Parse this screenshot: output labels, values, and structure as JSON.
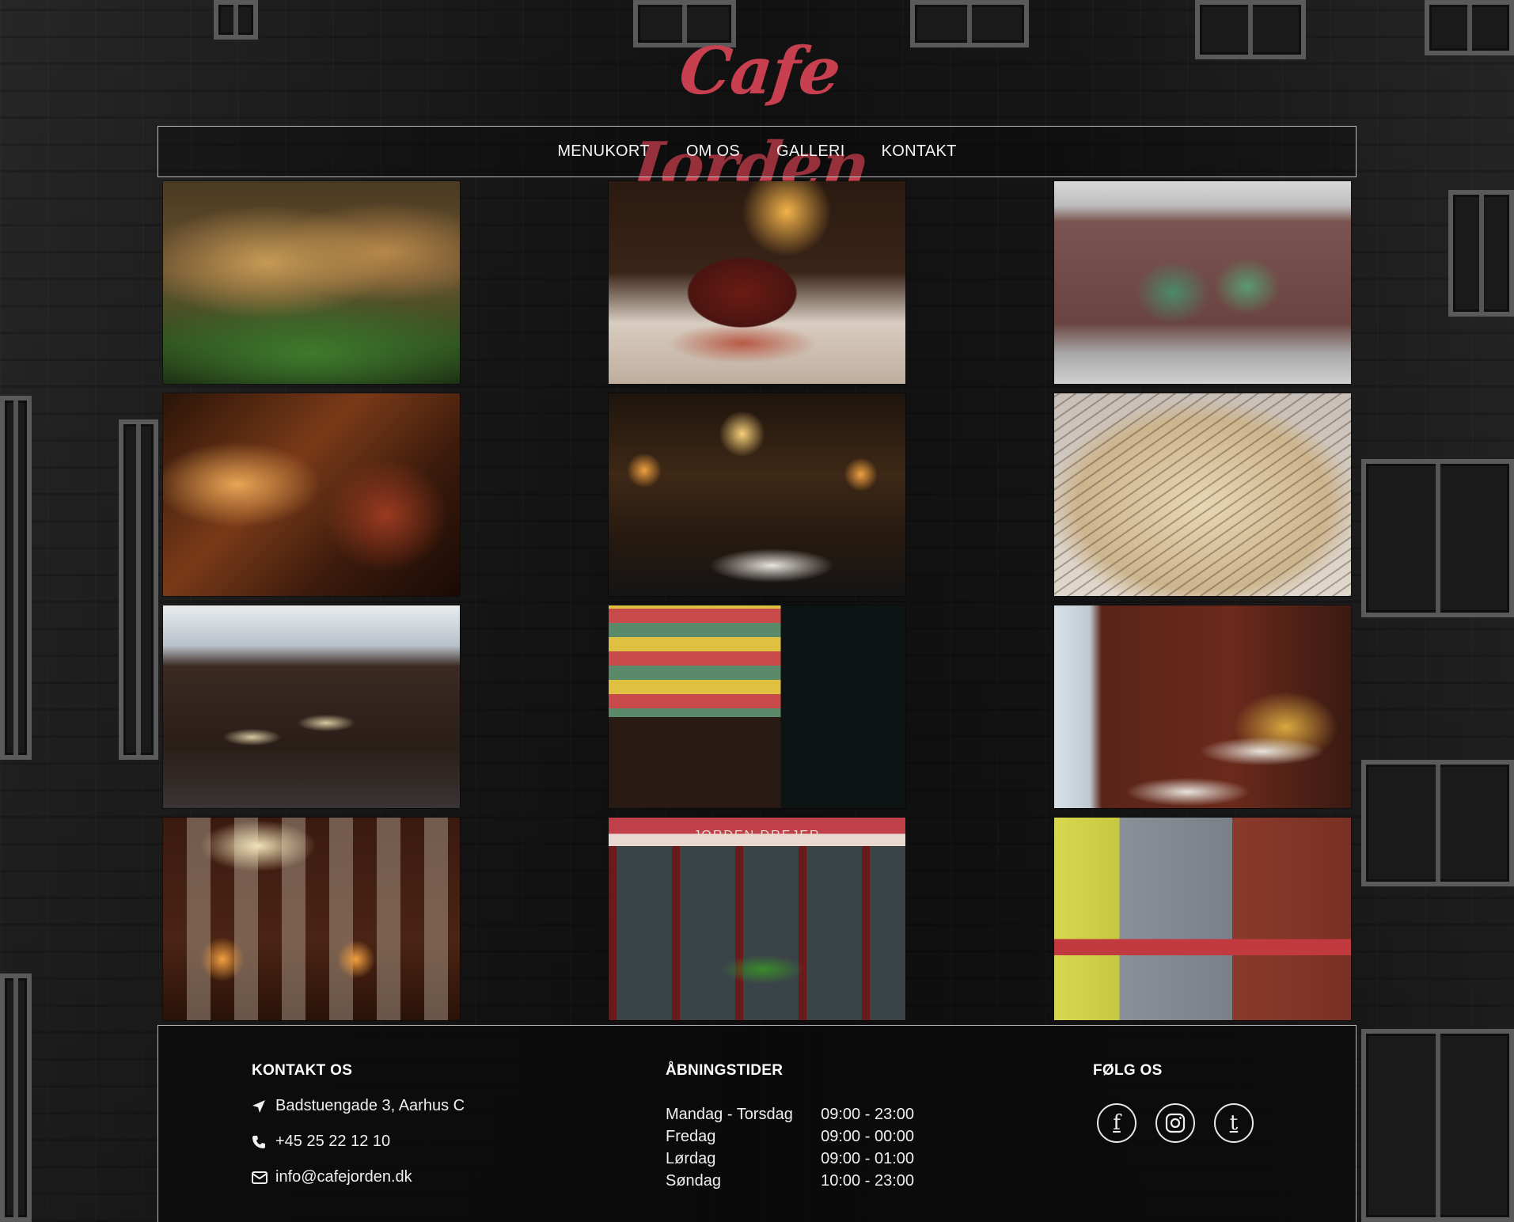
{
  "site": {
    "logo_text": "Cafe Jorden",
    "brand_color": "#c8404f"
  },
  "nav": {
    "items": [
      {
        "label": "MENUKORT"
      },
      {
        "label": "OM OS"
      },
      {
        "label": "GALLERI"
      },
      {
        "label": "KONTAKT"
      }
    ]
  },
  "gallery": {
    "photos": [
      {
        "subject": "sandwiches-photo"
      },
      {
        "subject": "coffee-cup-photo"
      },
      {
        "subject": "mural-wall-photo"
      },
      {
        "subject": "staircase-photo"
      },
      {
        "subject": "cafe-interior-lamps-photo"
      },
      {
        "subject": "menu-card-photo"
      },
      {
        "subject": "dining-room-tables-photo"
      },
      {
        "subject": "payphone-postcards-photo"
      },
      {
        "subject": "window-table-photo"
      },
      {
        "subject": "picture-wall-photo"
      },
      {
        "subject": "storefront-awning-photo"
      },
      {
        "subject": "street-facade-photo"
      }
    ],
    "storefront_sign": "JORDEN DREJER"
  },
  "footer": {
    "contact": {
      "heading": "KONTAKT OS",
      "address": "Badstuengade 3, Aarhus C",
      "phone": "+45 25 22 12 10",
      "email": "info@cafejorden.dk",
      "icons": [
        "location-arrow-icon",
        "phone-icon",
        "envelope-icon"
      ]
    },
    "hours": {
      "heading": "ÅBNINGSTIDER",
      "rows": [
        {
          "day": "Mandag - Torsdag",
          "time": "09:00 - 23:00"
        },
        {
          "day": "Fredag",
          "time": "09:00 - 00:00"
        },
        {
          "day": "Lørdag",
          "time": "09:00 - 01:00"
        },
        {
          "day": "Søndag",
          "time": "10:00 - 23:00"
        }
      ]
    },
    "social": {
      "heading": "FØLG OS",
      "networks": [
        {
          "icon": "facebook-icon",
          "glyph": "f"
        },
        {
          "icon": "instagram-icon",
          "glyph": "◎"
        },
        {
          "icon": "tumblr-icon",
          "glyph": "t"
        }
      ]
    }
  }
}
